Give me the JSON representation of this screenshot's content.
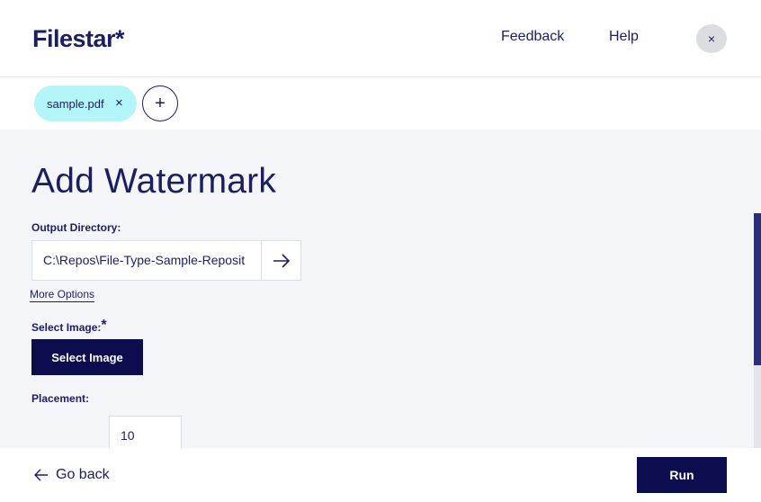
{
  "header": {
    "logo": "Filestar*",
    "feedback": "Feedback",
    "help": "Help",
    "close_icon": "×"
  },
  "files": {
    "chip_label": "sample.pdf",
    "chip_close": "×",
    "add_icon": "+"
  },
  "main": {
    "title": "Add Watermark",
    "output_directory_label": "Output Directory:",
    "output_directory_value": "C:\\Repos\\File-Type-Sample-Reposit",
    "more_options": "More Options",
    "select_image_label": "Select Image:",
    "select_image_required": "*",
    "select_image_button": "Select Image",
    "placement_label": "Placement:",
    "placement_value": "10"
  },
  "footer": {
    "go_back": "Go back",
    "run": "Run"
  },
  "colors": {
    "brand_navy": "#1b1f5e",
    "button_dark": "#0c0c4e",
    "chip_cyan": "#b3f5f8",
    "content_bg": "#f4f5f8",
    "scroll_thumb": "#2b2f78"
  },
  "icons": {
    "close": "close-icon",
    "add": "plus-icon",
    "go": "arrow-right-icon",
    "back": "arrow-left-icon"
  }
}
